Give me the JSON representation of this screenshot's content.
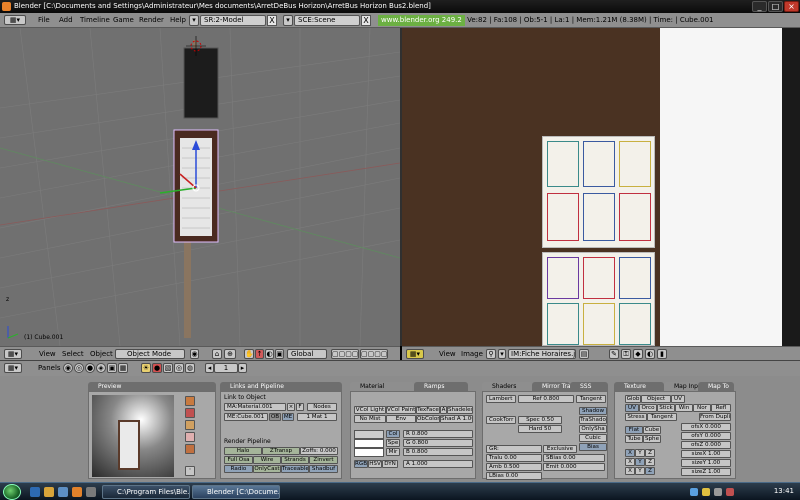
{
  "window": {
    "title": "Blender [C:\\Documents and Settings\\Administrateur\\Mes documents\\ArretDeBus Horizon\\ArretBus Horizon Bus2.blend]",
    "minimize": "_",
    "maximize": "□",
    "close": "×"
  },
  "header": {
    "menus": [
      "File",
      "Add",
      "Timeline",
      "Game",
      "Render",
      "Help"
    ],
    "screen": "SR:2-Model",
    "scene": "SCE:Scene",
    "close_glyph": "X",
    "url": "www.blender.org 249.2",
    "stats": "Ve:82 | Fa:108 | Ob:5-1 | La:1 | Mem:1.21M (8.38M) | Time: | Cube.001"
  },
  "viewport3d": {
    "object_label": "(1) Cube.001",
    "axis_label": "z"
  },
  "header3d": {
    "menus": [
      "View",
      "Select",
      "Object"
    ],
    "mode": "Object Mode",
    "orientation": "Global"
  },
  "image_editor": {
    "menus": [
      "View",
      "Image"
    ],
    "image_name": "IM:Fiche Horaires.jpg"
  },
  "buttons_header": {
    "label": "Panels",
    "frame": "1"
  },
  "panels": {
    "preview": {
      "tab": "Preview"
    },
    "links": {
      "tab": "Links and Pipeline",
      "link_label": "Link to Object",
      "material": "MA:Material.001",
      "f": "F",
      "nodes": "Nodes",
      "me": "ME:Cube.001",
      "ob": "OB",
      "me_btn": "ME",
      "mat": "1 Mat 1",
      "pipeline_label": "Render Pipeline",
      "buttons": [
        "Halo",
        "ZTransp",
        "Zoffs: 0.000",
        "Full Osa",
        "Wire",
        "Strands",
        "Zinvert",
        "Radio",
        "OnlyCast",
        "Traceable",
        "Shadbuf"
      ]
    },
    "material": {
      "tab": "Material",
      "tab2": "Ramps",
      "row1": [
        "VCol Light",
        "VCol Paint",
        "TexFace",
        "A",
        "Shadeless"
      ],
      "row2": [
        "No Mist",
        "Env",
        "ObColor",
        "Shad A 1.000"
      ],
      "colors": [
        "Col",
        "Spe",
        "Mir"
      ],
      "rgb": [
        "R 0.800",
        "G 0.800",
        "B 0.800"
      ],
      "modes": [
        "RGB",
        "HSV",
        "DYN"
      ],
      "alpha": "A 1.000"
    },
    "shaders": {
      "tab": "Shaders",
      "tab2": "Mirror Tran",
      "tab3": "SSS",
      "lambert": "Lambert",
      "ref": "Ref 0.800",
      "tangent": "Tangent",
      "cooktorr": "CookTorr",
      "spec": "Spec 0.50",
      "hard": "Hard 50",
      "side": [
        "Shadow",
        "TraShado",
        "OnlySha",
        "Cubic",
        "Bias"
      ],
      "gr": "GR:",
      "exclusive": "Exclusive",
      "tralu": "Tralu 0.00",
      "sbias": "SBias 0.00",
      "amb": "Amb 0.500",
      "emit": "Emit 0.000",
      "lbias": "LBias 0.00"
    },
    "texture": {
      "tab": "Texture",
      "tab2": "Map Input",
      "tab3": "Map To",
      "row1": [
        "Glob",
        "Object",
        "UV"
      ],
      "row2": [
        "UV",
        "Orco",
        "Stick",
        "Win",
        "Nor",
        "Refl"
      ],
      "row3": [
        "Stress",
        "Tangent",
        "From Dupli"
      ],
      "flat": "Flat",
      "cube": "Cube",
      "tube": "Tube",
      "sphe": "Sphe",
      "ofs": [
        "ofsX 0.000",
        "ofsY 0.000",
        "ofsZ 0.000"
      ],
      "size": [
        "sizeX 1.00",
        "sizeY 1.00",
        "sizeZ 1.00"
      ],
      "xyz": [
        "X",
        "Y",
        "Z"
      ]
    }
  },
  "taskbar": {
    "items": [
      "C:\\Program Files\\Ble...",
      "Blender [C:\\Docume..."
    ],
    "clock": "13:41"
  }
}
